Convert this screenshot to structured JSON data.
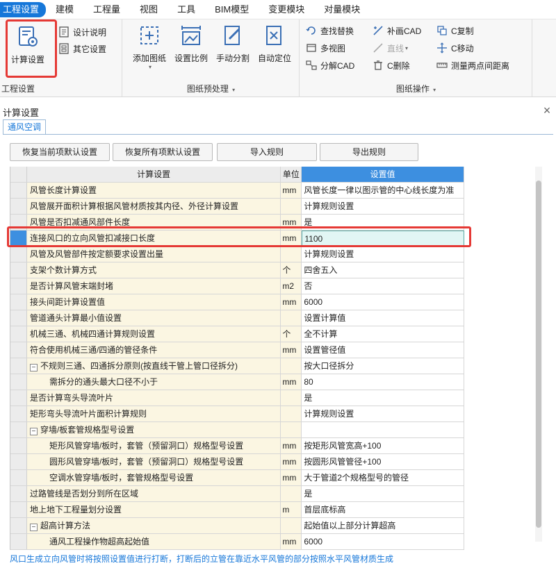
{
  "menubar": {
    "items": [
      {
        "label": "工程设置",
        "active": true
      },
      {
        "label": "建模"
      },
      {
        "label": "工程量"
      },
      {
        "label": "视图"
      },
      {
        "label": "工具"
      },
      {
        "label": "BIM模型"
      },
      {
        "label": "变更模块"
      },
      {
        "label": "对量模块"
      }
    ]
  },
  "ribbon": {
    "project_settings": {
      "calc_settings": "计算设置",
      "design_notes": "设计说明",
      "other_settings": "其它设置",
      "group_label": "工程设置"
    },
    "drawing_preprocess": {
      "add_drawing": "添加图纸",
      "set_scale": "设置比例",
      "manual_split": "手动分割",
      "auto_locate": "自动定位",
      "group_label": "图纸预处理"
    },
    "drawing_ops": {
      "find_replace": "查找替换",
      "multi_view": "多视图",
      "explode_cad": "分解CAD",
      "redraw_cad": "补画CAD",
      "line": "直线",
      "c_delete": "C删除",
      "c_copy": "C复制",
      "c_move": "C移动",
      "measure_distance": "测量两点间距离",
      "group_label": "图纸操作"
    }
  },
  "dialog": {
    "title": "计算设置",
    "tab": "通风空调",
    "buttons": {
      "restore_current": "恢复当前项默认设置",
      "restore_all": "恢复所有项默认设置",
      "import_rules": "导入规则",
      "export_rules": "导出规则"
    },
    "columns": {
      "setting": "计算设置",
      "unit": "单位",
      "value": "设置值"
    },
    "rows": [
      {
        "name": "风管长度计算设置",
        "unit": "mm",
        "value": "风管长度一律以图示管的中心线长度为准"
      },
      {
        "name": "风管展开面积计算根据风管材质按其内径、外径计算设置",
        "unit": "",
        "value": "计算规则设置"
      },
      {
        "name": "风管是否扣减通风部件长度",
        "unit": "mm",
        "value": "是"
      },
      {
        "name": "连接风口的立向风管扣减接口长度",
        "unit": "mm",
        "value": "1100"
      },
      {
        "name": "风管及风管部件按定额要求设置出量",
        "unit": "",
        "value": "计算规则设置"
      },
      {
        "name": "支架个数计算方式",
        "unit": "个",
        "value": "四舍五入"
      },
      {
        "name": "是否计算风管末端封堵",
        "unit": "m2",
        "value": "否"
      },
      {
        "name": "接头间距计算设置值",
        "unit": "mm",
        "value": "6000"
      },
      {
        "name": "管道通头计算最小值设置",
        "unit": "",
        "value": "设置计算值"
      },
      {
        "name": "机械三通、机械四通计算规则设置",
        "unit": "个",
        "value": "全不计算"
      },
      {
        "name": "符合使用机械三通/四通的管径条件",
        "unit": "mm",
        "value": "设置管径值"
      },
      {
        "name": "不规则三通、四通拆分原则(按直线干管上管口径拆分)",
        "unit": "",
        "value": "按大口径拆分"
      },
      {
        "name": "需拆分的通头最大口径不小于",
        "unit": "mm",
        "value": "80"
      },
      {
        "name": "是否计算弯头导流叶片",
        "unit": "",
        "value": "是"
      },
      {
        "name": "矩形弯头导流叶片面积计算规则",
        "unit": "",
        "value": "计算规则设置"
      },
      {
        "name": "穿墙/板套管规格型号设置",
        "unit": "",
        "value": ""
      },
      {
        "name": "矩形风管穿墙/板时，套管（预留洞口）规格型号设置",
        "unit": "mm",
        "value": "按矩形风管宽高+100"
      },
      {
        "name": "圆形风管穿墙/板时，套管（预留洞口）规格型号设置",
        "unit": "mm",
        "value": "按圆形风管管径+100"
      },
      {
        "name": "空调水管穿墙/板时，套管规格型号设置",
        "unit": "mm",
        "value": "大于管道2个规格型号的管径"
      },
      {
        "name": "过路管线是否划分到所在区域",
        "unit": "",
        "value": "是"
      },
      {
        "name": "地上地下工程量划分设置",
        "unit": "m",
        "value": "首层底标高"
      },
      {
        "name": "超高计算方法",
        "unit": "",
        "value": "起始值以上部分计算超高"
      },
      {
        "name": "通风工程操作物超高起始值",
        "unit": "mm",
        "value": "6000"
      }
    ],
    "description": "风口生成立向风管时将按照设置值进行打断，打断后的立管在靠近水平风管的部分按照水平风管材质生成"
  },
  "toggle_symbol": "−",
  "close_symbol": "×",
  "accent_color": "#1677d9",
  "highlight_color": "#e53935"
}
